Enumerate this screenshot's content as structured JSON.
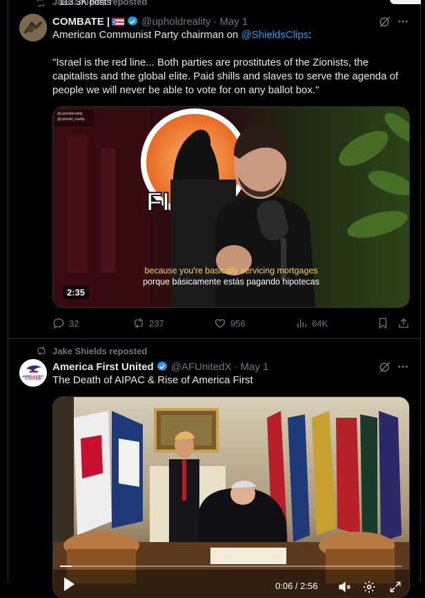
{
  "sticky": {
    "ghost_text": "Jake Shields reposted",
    "posts_count": "113.3K posts"
  },
  "tweets": [
    {
      "author_name": "COMBATE |",
      "handle": "@upholdreality",
      "date": "May 1",
      "text_line1_prefix": "American Communist Party chairman on ",
      "text_line1_link": "@ShieldsClips",
      "text_line1_suffix": ":",
      "quote": "\"Israel is the red line... Both parties are prostitutes of the Zionists, the capitalists and the global elite. Paid shills and slaves to serve the agenda of people we will never be able to vote for on any ballot box.\"",
      "media": {
        "watermark_line1": "@upholdreality",
        "watermark_line2": "@uphold_reality",
        "subtitle_en": "because you're basically servicing mortgages",
        "subtitle_es": "porque básicamente estás pagando hipotecas",
        "duration": "2:35"
      },
      "stats": {
        "replies": "32",
        "reposts": "237",
        "likes": "956",
        "views": "64K"
      }
    },
    {
      "repost_label": "Jake Shields reposted",
      "author_name": "America First United",
      "handle": "@AFUnitedX",
      "date": "May 1",
      "text": "The Death of AIPAC & Rise of America First",
      "avatar_text_1": "AMERICA FIRST",
      "avatar_text_2": "UNITED",
      "media": {
        "time": "0:06 / 2:56",
        "progress": 0.034
      }
    }
  ],
  "colors": {
    "accent": "#1d9bf0",
    "muted": "#71767b",
    "border": "#2f3336",
    "background": "#000000",
    "verified": "#1d9bf0"
  },
  "icons": {
    "reply": "reply-icon",
    "repost": "repost-icon",
    "like": "heart-icon",
    "views": "views-icon",
    "bookmark": "bookmark-icon",
    "share": "share-icon",
    "grok": "grok-icon",
    "more": "more-icon"
  }
}
